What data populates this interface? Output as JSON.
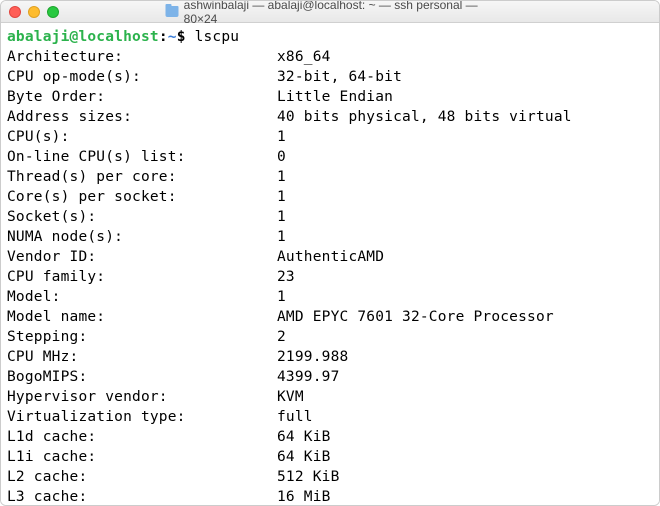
{
  "window": {
    "title": "ashwinbalaji — abalaji@localhost: ~ — ssh personal — 80×24"
  },
  "prompt": {
    "user_host": "abalaji@localhost",
    "sep": ":",
    "path": "~",
    "symbol": "$",
    "command": "lscpu"
  },
  "rows": [
    {
      "key": "Architecture:",
      "val": "x86_64"
    },
    {
      "key": "CPU op-mode(s):",
      "val": "32-bit, 64-bit"
    },
    {
      "key": "Byte Order:",
      "val": "Little Endian"
    },
    {
      "key": "Address sizes:",
      "val": "40 bits physical, 48 bits virtual"
    },
    {
      "key": "CPU(s):",
      "val": "1"
    },
    {
      "key": "On-line CPU(s) list:",
      "val": "0"
    },
    {
      "key": "Thread(s) per core:",
      "val": "1"
    },
    {
      "key": "Core(s) per socket:",
      "val": "1"
    },
    {
      "key": "Socket(s):",
      "val": "1"
    },
    {
      "key": "NUMA node(s):",
      "val": "1"
    },
    {
      "key": "Vendor ID:",
      "val": "AuthenticAMD"
    },
    {
      "key": "CPU family:",
      "val": "23"
    },
    {
      "key": "Model:",
      "val": "1"
    },
    {
      "key": "Model name:",
      "val": "AMD EPYC 7601 32-Core Processor"
    },
    {
      "key": "Stepping:",
      "val": "2"
    },
    {
      "key": "CPU MHz:",
      "val": "2199.988"
    },
    {
      "key": "BogoMIPS:",
      "val": "4399.97"
    },
    {
      "key": "Hypervisor vendor:",
      "val": "KVM"
    },
    {
      "key": "Virtualization type:",
      "val": "full"
    },
    {
      "key": "L1d cache:",
      "val": "64 KiB"
    },
    {
      "key": "L1i cache:",
      "val": "64 KiB"
    },
    {
      "key": "L2 cache:",
      "val": "512 KiB"
    },
    {
      "key": "L3 cache:",
      "val": "16 MiB"
    }
  ]
}
